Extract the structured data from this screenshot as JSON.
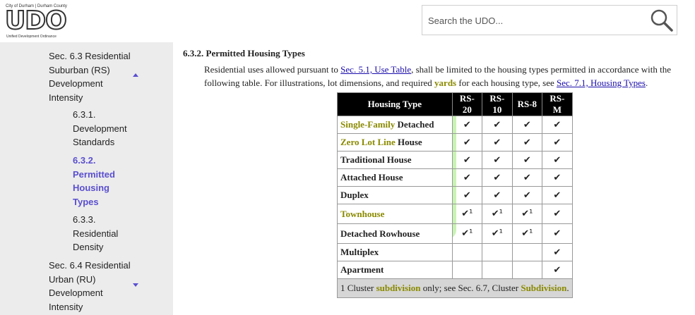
{
  "logo": {
    "top_text": "City of Durham | Durham County",
    "wordmark": "UDO",
    "sub_text": "Unified Development Ordinance"
  },
  "search": {
    "placeholder": "Search the UDO..."
  },
  "sidebar": {
    "items": [
      {
        "label": "Sec. 6.3 Residential Suburban (RS) Development Intensity",
        "level": 1,
        "arrow": "up"
      },
      {
        "label": "6.3.1. Development Standards",
        "level": 2
      },
      {
        "label": "6.3.2. Permitted Housing Types",
        "level": 2,
        "active": true
      },
      {
        "label": "6.3.3. Residential Density",
        "level": 2
      },
      {
        "label": "Sec. 6.4 Residential Urban (RU) Development Intensity",
        "level": 1,
        "arrow": "down"
      }
    ]
  },
  "main": {
    "heading": "6.3.2. Permitted Housing Types",
    "para": {
      "t1": "Residential uses allowed pursuant to ",
      "link1": "Sec. 5.1, Use Table",
      "t2": ", shall be limited to the housing types permitted in accordance with the following table. For illustrations, lot dimensions, and required ",
      "hl1": "yards",
      "t3": " for each housing type, see ",
      "link2": "Sec. 7.1, Housing Types",
      "t4": "."
    },
    "table": {
      "headers": [
        "Housing Type",
        "RS-20",
        "RS-10",
        "RS-8",
        "RS-M"
      ],
      "rows": [
        {
          "hl": "Single-Family",
          "rest": " Detached",
          "cells": [
            "✔",
            "✔",
            "✔",
            "✔"
          ]
        },
        {
          "hl": "Zero Lot Line",
          "rest": " House",
          "cells": [
            "✔",
            "✔",
            "✔",
            "✔"
          ]
        },
        {
          "hl": "",
          "rest": "Traditional House",
          "cells": [
            "✔",
            "✔",
            "✔",
            "✔"
          ]
        },
        {
          "hl": "",
          "rest": "Attached House",
          "cells": [
            "✔",
            "✔",
            "✔",
            "✔"
          ]
        },
        {
          "hl": "",
          "rest": "Duplex",
          "cells": [
            "✔",
            "✔",
            "✔",
            "✔"
          ]
        },
        {
          "hl": "Townhouse",
          "rest": "",
          "cells": [
            "✔¹",
            "✔¹",
            "✔¹",
            "✔"
          ]
        },
        {
          "hl": "",
          "rest": "Detached Rowhouse",
          "cells": [
            "✔¹",
            "✔¹",
            "✔¹",
            "✔"
          ]
        },
        {
          "hl": "",
          "rest": "Multiplex",
          "cells": [
            "",
            "",
            "",
            "✔"
          ]
        },
        {
          "hl": "",
          "rest": "Apartment",
          "cells": [
            "",
            "",
            "",
            "✔"
          ]
        }
      ],
      "footnote": {
        "t1": "1 Cluster ",
        "hl1": "subdivision",
        "t2": " only; see Sec. 6.7, Cluster ",
        "hl2": "Subdivision",
        "t3": "."
      }
    }
  }
}
